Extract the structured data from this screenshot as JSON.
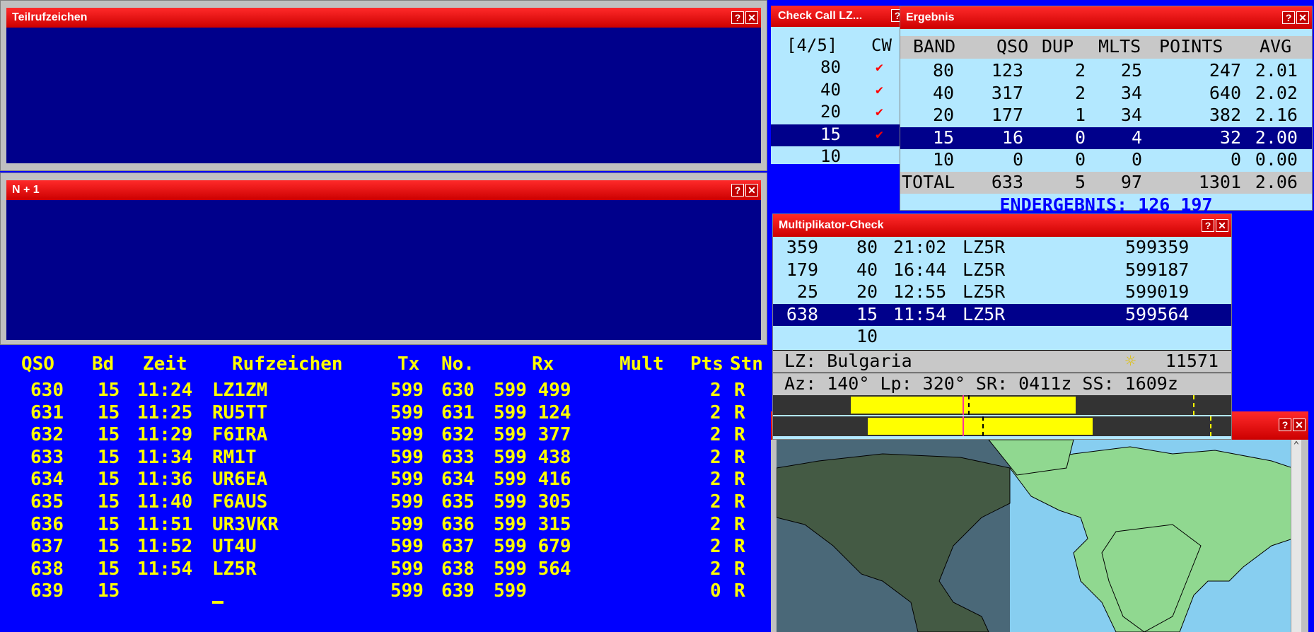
{
  "windows": {
    "teilruf": {
      "title": "Teilrufzeichen"
    },
    "nplus1": {
      "title": "N + 1"
    },
    "checkcall": {
      "title": "Check Call LZ...",
      "header": [
        "[4/5]",
        "CW"
      ],
      "rows": [
        {
          "band": "80",
          "check": "✔"
        },
        {
          "band": "40",
          "check": "✔"
        },
        {
          "band": "20",
          "check": "✔"
        },
        {
          "band": "15",
          "check": "✔"
        },
        {
          "band": "10",
          "check": ""
        }
      ]
    },
    "ergebnis": {
      "title": "Ergebnis",
      "header": [
        "BAND",
        "QSO",
        "DUP",
        "MLTS",
        "POINTS",
        "AVG"
      ],
      "rows": [
        [
          "80",
          "123",
          "2",
          "25",
          "247",
          "2.01"
        ],
        [
          "40",
          "317",
          "2",
          "34",
          "640",
          "2.02"
        ],
        [
          "20",
          "177",
          "1",
          "34",
          "382",
          "2.16"
        ],
        [
          "15",
          "16",
          "0",
          "4",
          "32",
          "2.00"
        ],
        [
          "10",
          "0",
          "0",
          "0",
          "0",
          "0.00"
        ]
      ],
      "total": [
        "TOTAL",
        "633",
        "5",
        "97",
        "1301",
        "2.06"
      ],
      "final": "ENDERGEBNIS: 126 197"
    },
    "multiplier": {
      "title": "Multiplikator-Check",
      "rows": [
        [
          "359",
          "80",
          "21:02",
          "LZ5R",
          "599359"
        ],
        [
          "179",
          "40",
          "16:44",
          "LZ5R",
          "599187"
        ],
        [
          "25",
          "20",
          "12:55",
          "LZ5R",
          "599019"
        ],
        [
          "638",
          "15",
          "11:54",
          "LZ5R",
          "599564"
        ],
        [
          "",
          "10",
          "",
          "",
          ""
        ]
      ],
      "country": "LZ: Bulgaria",
      "distance": "11571",
      "azimuth": "Az: 140° Lp: 320° SR: 0411z SS: 1609z"
    }
  },
  "log": {
    "header": {
      "qso": "QSO",
      "bd": "Bd",
      "zeit": "Zeit",
      "call": "Rufzeichen",
      "tx": "Tx",
      "no": "No.",
      "rx": "Rx",
      "mult": "Mult",
      "pts": "Pts",
      "stn": "Stn"
    },
    "rows": [
      {
        "qso": "630",
        "bd": "15",
        "zeit": "11:24",
        "call": "LZ1ZM",
        "tx": "599",
        "no": "630",
        "rx": "599 499",
        "pts": "2",
        "stn": "R"
      },
      {
        "qso": "631",
        "bd": "15",
        "zeit": "11:25",
        "call": "RU5TT",
        "tx": "599",
        "no": "631",
        "rx": "599 124",
        "pts": "2",
        "stn": "R"
      },
      {
        "qso": "632",
        "bd": "15",
        "zeit": "11:29",
        "call": "F6IRA",
        "tx": "599",
        "no": "632",
        "rx": "599 377",
        "pts": "2",
        "stn": "R"
      },
      {
        "qso": "633",
        "bd": "15",
        "zeit": "11:34",
        "call": "RM1T",
        "tx": "599",
        "no": "633",
        "rx": "599 438",
        "pts": "2",
        "stn": "R"
      },
      {
        "qso": "634",
        "bd": "15",
        "zeit": "11:36",
        "call": "UR6EA",
        "tx": "599",
        "no": "634",
        "rx": "599 416",
        "pts": "2",
        "stn": "R"
      },
      {
        "qso": "635",
        "bd": "15",
        "zeit": "11:40",
        "call": "F6AUS",
        "tx": "599",
        "no": "635",
        "rx": "599 305",
        "pts": "2",
        "stn": "R"
      },
      {
        "qso": "636",
        "bd": "15",
        "zeit": "11:51",
        "call": "UR3VKR",
        "tx": "599",
        "no": "636",
        "rx": "599 315",
        "pts": "2",
        "stn": "R"
      },
      {
        "qso": "637",
        "bd": "15",
        "zeit": "11:52",
        "call": "UT4U",
        "tx": "599",
        "no": "637",
        "rx": "599 679",
        "pts": "2",
        "stn": "R"
      },
      {
        "qso": "638",
        "bd": "15",
        "zeit": "11:54",
        "call": "LZ5R",
        "tx": "599",
        "no": "638",
        "rx": "599 564",
        "pts": "2",
        "stn": "R"
      },
      {
        "qso": "639",
        "bd": "15",
        "zeit": "",
        "call": "",
        "tx": "599",
        "no": "639",
        "rx": "599",
        "pts": "0",
        "stn": "R"
      }
    ]
  },
  "icons": {
    "help": "?",
    "close": "✕",
    "sun": "☼",
    "scroll_up": "⌃"
  },
  "colors": {
    "title": "#e00000",
    "navy": "#00008b",
    "blue": "#0000ff",
    "yellow": "#ffff00",
    "panel": "#b3e8ff"
  }
}
